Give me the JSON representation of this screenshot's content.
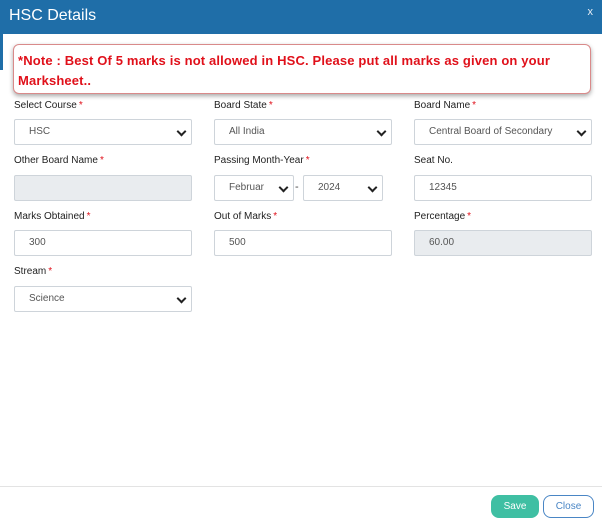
{
  "modal": {
    "title": "HSC Details",
    "close_glyph": "x"
  },
  "note": "*Note : Best Of 5 marks is not allowed in HSC. Please put all marks as given on your Marksheet..",
  "required_marker": "*",
  "fields": {
    "select_course": {
      "label": "Select Course",
      "value": "HSC"
    },
    "board_state": {
      "label": "Board State",
      "value": "All India"
    },
    "board_name": {
      "label": "Board Name",
      "value": "Central Board of Secondary"
    },
    "other_board_name": {
      "label": "Other Board Name",
      "value": ""
    },
    "passing_month_year": {
      "label": "Passing Month-Year",
      "month": "Februar",
      "separator": "-",
      "year": "2024"
    },
    "seat_no": {
      "label": "Seat No.",
      "value": "12345"
    },
    "marks_obtained": {
      "label": "Marks Obtained",
      "value": "300"
    },
    "out_of_marks": {
      "label": "Out of Marks",
      "value": "500"
    },
    "percentage": {
      "label": "Percentage",
      "value": "60.00"
    },
    "stream": {
      "label": "Stream",
      "value": "Science"
    }
  },
  "footer": {
    "save_label": "Save",
    "close_label": "Close"
  },
  "colors": {
    "header": "#1f6ea8",
    "note_text": "#e0101a",
    "save_button": "#3fbfa3",
    "close_button": "#4a86c5"
  },
  "icons": {
    "close": "close-icon",
    "dropdown": "chevron-down-icon"
  }
}
